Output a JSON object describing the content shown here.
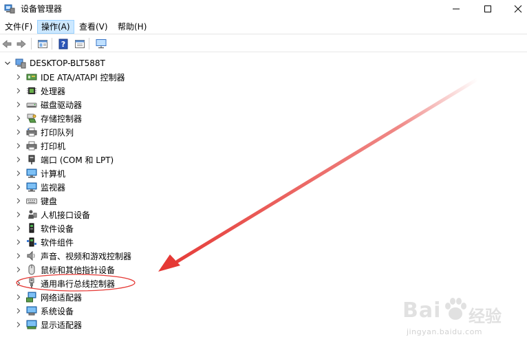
{
  "window": {
    "title": "设备管理器"
  },
  "menu": {
    "items": [
      "文件(F)",
      "操作(A)",
      "查看(V)",
      "帮助(H)"
    ],
    "active_index": 1
  },
  "toolbar": {
    "buttons": [
      "back-arrow-icon",
      "forward-arrow-icon",
      "properties-icon",
      "help-icon",
      "view-icon",
      "monitor-icon"
    ]
  },
  "tree": {
    "root": "DESKTOP-BLT588T",
    "items": [
      {
        "label": "IDE ATA/ATAPI 控制器",
        "icon": "ide-controller-icon"
      },
      {
        "label": "处理器",
        "icon": "processor-icon"
      },
      {
        "label": "磁盘驱动器",
        "icon": "disk-drive-icon"
      },
      {
        "label": "存储控制器",
        "icon": "storage-controller-icon"
      },
      {
        "label": "打印队列",
        "icon": "print-queue-icon"
      },
      {
        "label": "打印机",
        "icon": "printer-icon"
      },
      {
        "label": "端口 (COM 和 LPT)",
        "icon": "port-icon"
      },
      {
        "label": "计算机",
        "icon": "computer-icon"
      },
      {
        "label": "监视器",
        "icon": "monitor-icon"
      },
      {
        "label": "键盘",
        "icon": "keyboard-icon"
      },
      {
        "label": "人机接口设备",
        "icon": "hid-icon"
      },
      {
        "label": "软件设备",
        "icon": "software-device-icon"
      },
      {
        "label": "软件组件",
        "icon": "software-component-icon"
      },
      {
        "label": "声音、视频和游戏控制器",
        "icon": "sound-icon"
      },
      {
        "label": "鼠标和其他指针设备",
        "icon": "mouse-icon"
      },
      {
        "label": "通用串行总线控制器",
        "icon": "usb-controller-icon"
      },
      {
        "label": "网络适配器",
        "icon": "network-adapter-icon"
      },
      {
        "label": "系统设备",
        "icon": "system-device-icon"
      },
      {
        "label": "显示适配器",
        "icon": "display-adapter-icon"
      }
    ]
  },
  "annotation": {
    "color": "#e53935",
    "highlighted_item": "通用串行总线控制器"
  },
  "watermark": {
    "brand": "Bai",
    "brand2": "经验",
    "url": "jingyan.baidu.com"
  }
}
